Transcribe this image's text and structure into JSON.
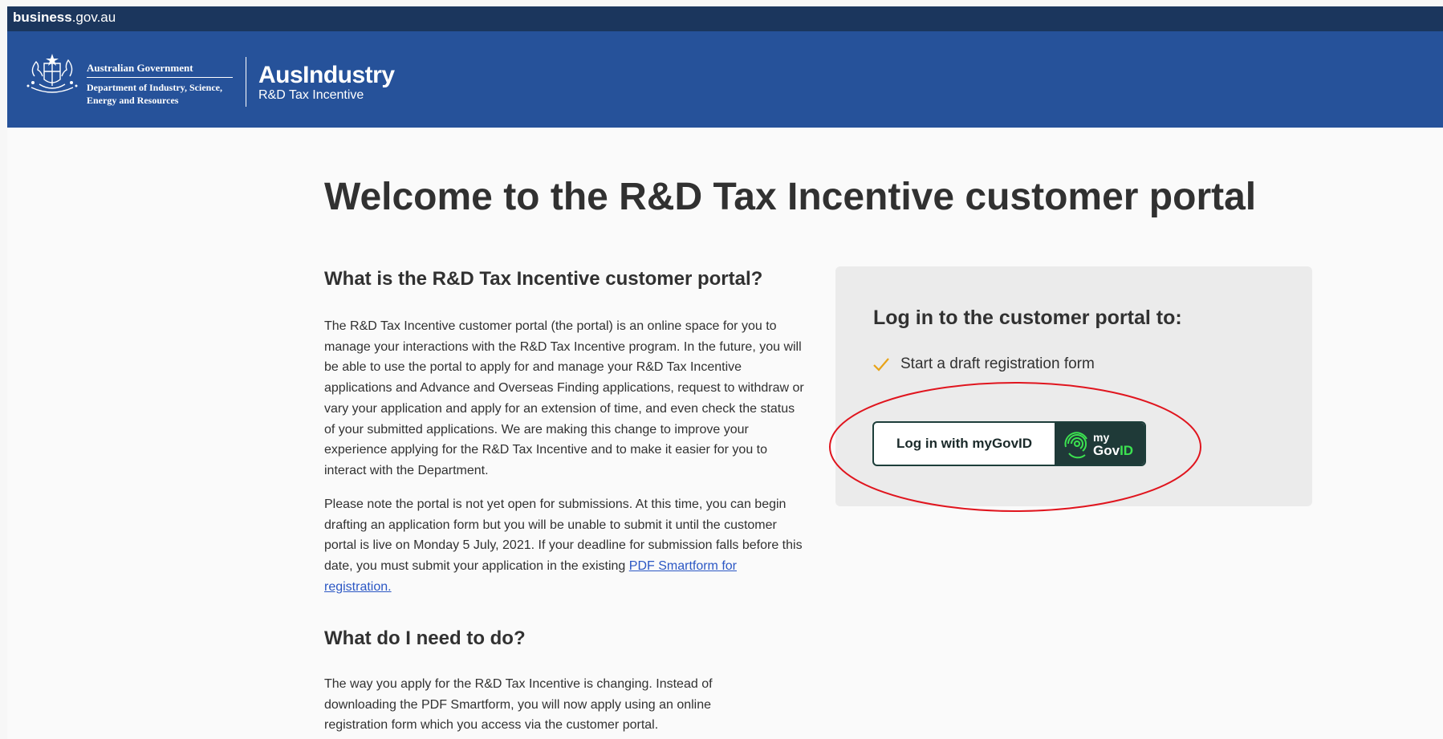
{
  "topbar": {
    "brand_bold": "business",
    "brand_rest": ".gov.au"
  },
  "header": {
    "gov_line1": "Australian Government",
    "gov_line2": "Department of Industry, Science,",
    "gov_line3": "Energy and Resources",
    "program_title": "AusIndustry",
    "program_subtitle": "R&D Tax Incentive"
  },
  "main": {
    "title": "Welcome to the R&D Tax Incentive customer portal",
    "section1_heading": "What is the R&D Tax Incentive customer portal?",
    "section1_para1": "The R&D Tax Incentive customer portal (the portal) is an online space for you to manage your interactions with the R&D Tax Incentive program. In the future, you will be able to use the portal to apply for and manage your R&D Tax Incentive applications and Advance and Overseas Finding applications, request to withdraw or vary your application and apply for an extension of time, and even check the status of your submitted applications. We are making this change to improve your experience applying for the R&D Tax Incentive and to make it easier for you to interact with the Department.",
    "section1_para2": "Please note the portal is not yet open for submissions. At this time, you can begin drafting an application form but you will be unable to submit it until the customer portal is live on Monday 5 July, 2021. If your deadline for submission falls before this date, you must submit your application in the existing ",
    "section1_link": "PDF Smartform for registration.",
    "section2_heading": "What do I need to do?",
    "section2_para1": "The way you apply for the R&D Tax Incentive is changing. Instead of downloading the PDF Smartform, you will now apply using an online registration form which you access via the customer portal."
  },
  "login_panel": {
    "heading": "Log in to the customer portal to:",
    "items": [
      {
        "label": "Start a draft registration form"
      }
    ],
    "button_label": "Log in with myGovID",
    "logo_text_top": "my",
    "logo_text_bottom_a": "Gov",
    "logo_text_bottom_b": "ID"
  },
  "colors": {
    "topbar": "#1b365d",
    "header": "#26529a",
    "check": "#e8a317",
    "mygovid_green": "#3ce250",
    "annotation": "#e0151e",
    "link": "#2b57c4"
  }
}
